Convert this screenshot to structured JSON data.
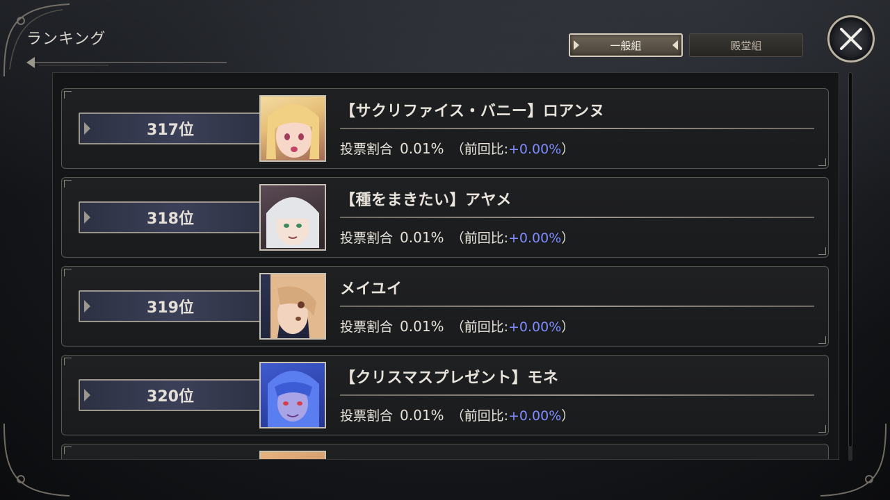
{
  "header": {
    "title": "ランキング"
  },
  "tabs": [
    {
      "label": "一般組",
      "active": true
    },
    {
      "label": "殿堂組",
      "active": false
    }
  ],
  "close_button": {
    "icon": "close-icon"
  },
  "ranking": {
    "vote_label": "投票割合",
    "prev_open": "（前回比:",
    "prev_close": "）",
    "rows": [
      {
        "rank": "317位",
        "name": "【サクリファイス・バニー】ロアンヌ",
        "share": "0.01%",
        "delta": "+0.00%",
        "portrait_color": "#e9c98a"
      },
      {
        "rank": "318位",
        "name": "【種をまきたい】アヤメ",
        "share": "0.01%",
        "delta": "+0.00%",
        "portrait_color": "#d8d9dc"
      },
      {
        "rank": "319位",
        "name": "メイユイ",
        "share": "0.01%",
        "delta": "+0.00%",
        "portrait_color": "#caa07a"
      },
      {
        "rank": "320位",
        "name": "【クリスマスプレゼント】モネ",
        "share": "0.01%",
        "delta": "+0.00%",
        "portrait_color": "#4a67c9"
      }
    ]
  },
  "colors": {
    "delta_text": "#7f8cff",
    "rank_plate": "#3b4058",
    "frame": "#9b978d"
  }
}
